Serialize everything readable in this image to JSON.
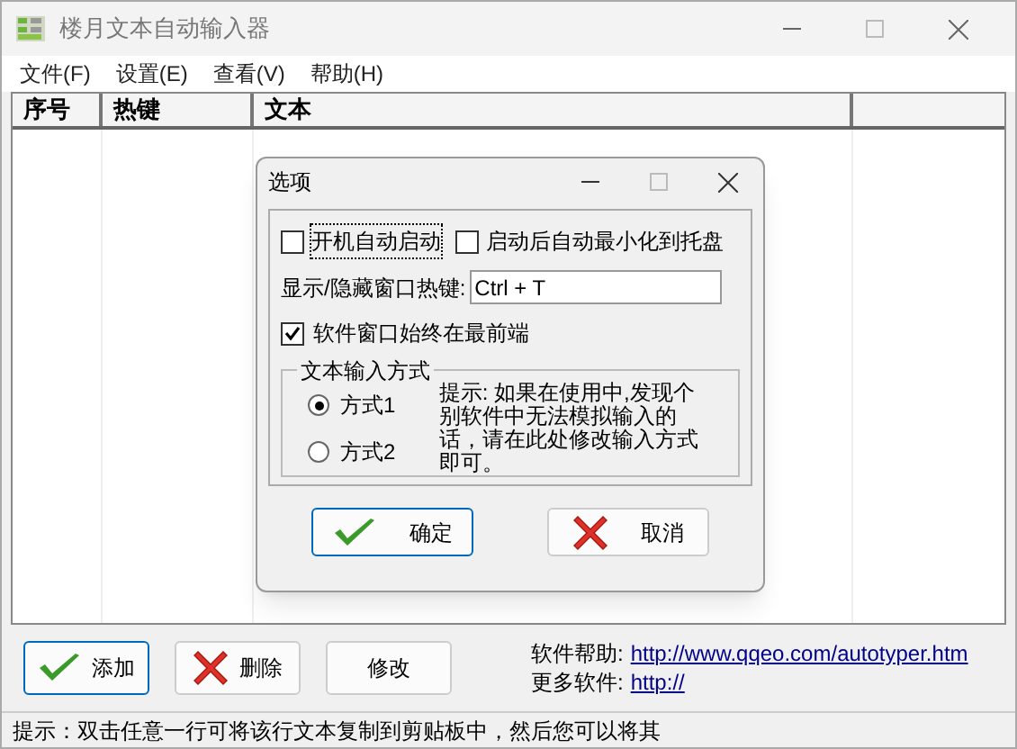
{
  "window": {
    "title": "楼月文本自动输入器"
  },
  "menu": [
    "文件(F)",
    "设置(E)",
    "查看(V)",
    "帮助(H)"
  ],
  "table": {
    "columns": [
      "序号",
      "热键",
      "文本"
    ]
  },
  "buttons": [
    {
      "label": "添加",
      "kind": "check"
    },
    {
      "label": "删除",
      "kind": "cross"
    },
    {
      "label": "修改",
      "kind": "plain"
    }
  ],
  "links": [
    {
      "label": "软件帮助:",
      "url": "http://www.qqeo.com/autotyper.htm"
    },
    {
      "label": "更多软件:",
      "url": "http://"
    }
  ],
  "status_bar": "提示：双击任意一行可将该行文本复制到剪贴板中，然后您可以将其",
  "dialog": {
    "title": "选项",
    "checks": [
      {
        "label": "开机自动启动",
        "checked": false,
        "focused": true
      },
      {
        "label": "启动后自动最小化到托盘",
        "checked": false,
        "focused": false
      }
    ],
    "hotkey_label": "显示/隐藏窗口热键:",
    "hotkey_value": "Ctrl + T",
    "topmost": {
      "label": "软件窗口始终在最前端",
      "checked": true
    },
    "group": {
      "title": "文本输入方式",
      "options": [
        {
          "label": "方式1",
          "selected": true
        },
        {
          "label": "方式2",
          "selected": false
        }
      ],
      "hint": "提示: 如果在使用中,发现个别软件中无法模拟输入的话，请在此处修改输入方式即可。"
    },
    "buttons": [
      {
        "label": "确定",
        "kind": "check"
      },
      {
        "label": "取消",
        "kind": "cross"
      }
    ]
  }
}
